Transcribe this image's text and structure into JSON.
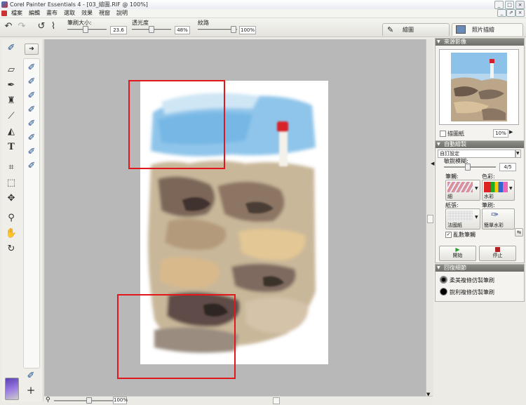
{
  "window": {
    "title": "Corel Painter Essentials 4 - [03_繪圖.RIF @ 100%]",
    "controls": [
      "_",
      "□",
      "×"
    ],
    "doc_controls": [
      "_",
      "⇗",
      "×"
    ]
  },
  "menu": [
    "檔案",
    "編輯",
    "畫布",
    "選取",
    "效果",
    "視窗",
    "說明"
  ],
  "property_bar": {
    "brush_size_label": "筆刷大小:",
    "brush_size_value": "23.6",
    "opacity_label": "透光度",
    "opacity_value": "48%",
    "grain_label": "紋路",
    "grain_value": "100%"
  },
  "tabs": {
    "paint": "繪圖",
    "photo_paint": "照片描繪"
  },
  "source_panel": {
    "title": "來源影像",
    "tracing_paper_label": "描圖紙",
    "zoom_value": "10%"
  },
  "auto_paint_panel": {
    "title": "自動繪製",
    "preset": "自訂設定",
    "sensitivity_label": "敏銳模糊:",
    "sensitivity_value": "4/5",
    "stroke_label": "筆觸:",
    "stroke_value": "細",
    "color_label": "色彩:",
    "color_value": "水彩",
    "paper_label": "紙張:",
    "paper_value": "法國紙",
    "brush_label": "筆刷:",
    "brush_value": "簡單水彩",
    "random_stroke_label": "亂數筆觸",
    "start_label": "開始",
    "stop_label": "停止"
  },
  "restore_panel": {
    "title": "回復細節",
    "soft_brush": "柔美複條仿製筆刷",
    "hard_brush": "銳利複條仿製筆刷"
  },
  "statusbar": {
    "zoom_value": "100%"
  },
  "colors": {
    "accent_red": "#e0181e",
    "start_green": "#2c9a2c",
    "stop_red": "#b02020",
    "panel_header": "#7b7b77"
  }
}
